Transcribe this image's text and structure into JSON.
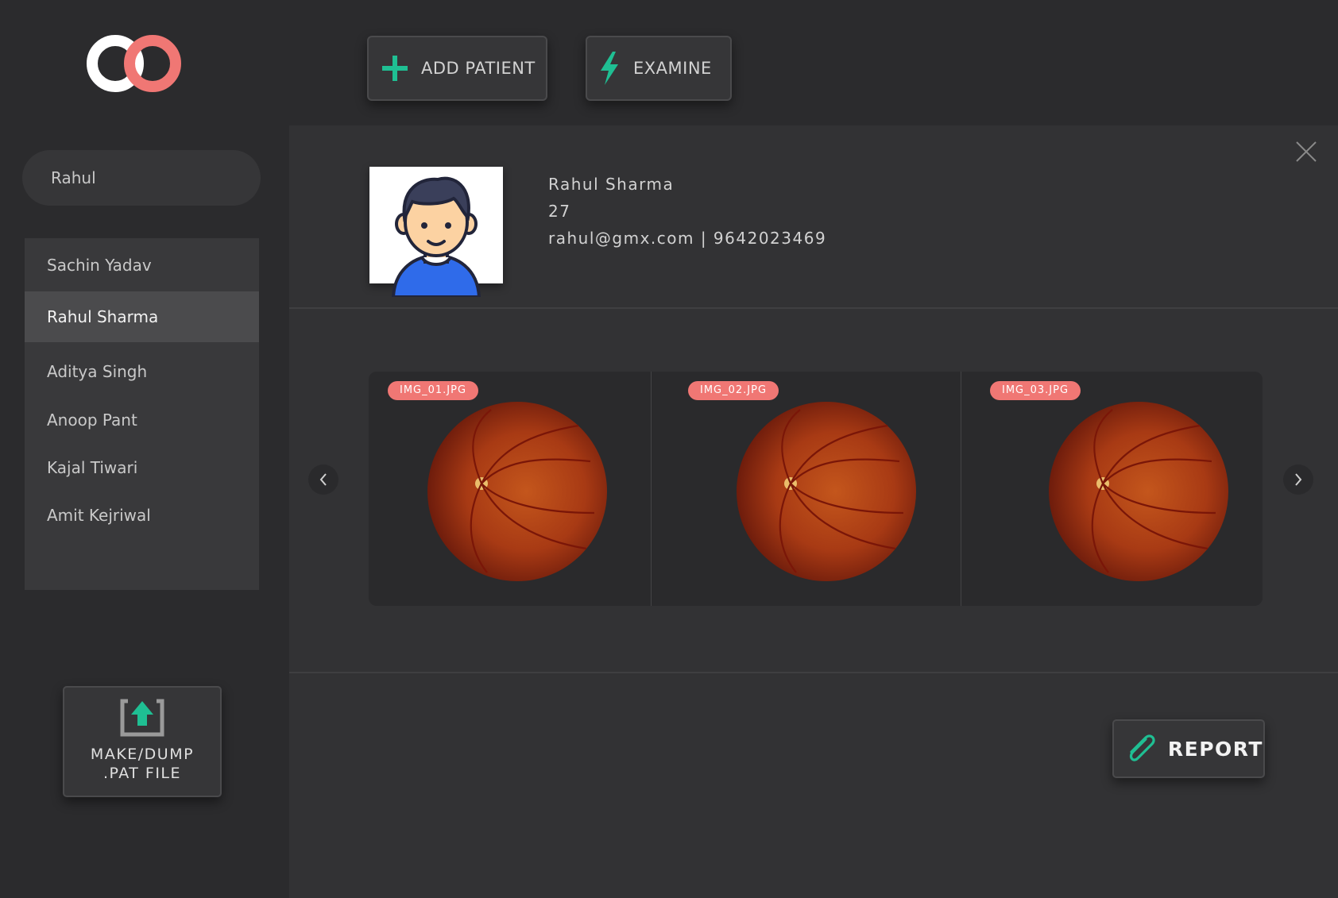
{
  "app": {
    "logo_icon": "infinity-logo-icon",
    "accent_color": "#f07774",
    "action_color": "#1fbf93"
  },
  "toolbar": {
    "add_patient_label": "ADD PATIENT",
    "add_patient_icon": "plus-icon",
    "examine_label": "EXAMINE",
    "examine_icon": "lightning-icon"
  },
  "search": {
    "value": "Rahul",
    "icon": "search-icon"
  },
  "patients": [
    {
      "name": "Sachin Yadav",
      "selected": false
    },
    {
      "name": "Rahul Sharma",
      "selected": true
    },
    {
      "name": "Aditya Singh",
      "selected": false
    },
    {
      "name": "Anoop Pant",
      "selected": false
    },
    {
      "name": "Kajal Tiwari",
      "selected": false
    },
    {
      "name": "Amit Kejriwal",
      "selected": false
    }
  ],
  "dump": {
    "line1": "MAKE/DUMP",
    "line2": ".PAT FILE",
    "icon": "upload-icon"
  },
  "patient": {
    "name": "Rahul Sharma",
    "age": "27",
    "contact": "rahul@gmx.com | 9642023469",
    "avatar_icon": "avatar-icon"
  },
  "images": [
    {
      "filename": "IMG_01.JPG"
    },
    {
      "filename": "IMG_02.JPG"
    },
    {
      "filename": "IMG_03.JPG"
    }
  ],
  "report": {
    "label": "REPORT",
    "icon": "paperclip-icon"
  }
}
